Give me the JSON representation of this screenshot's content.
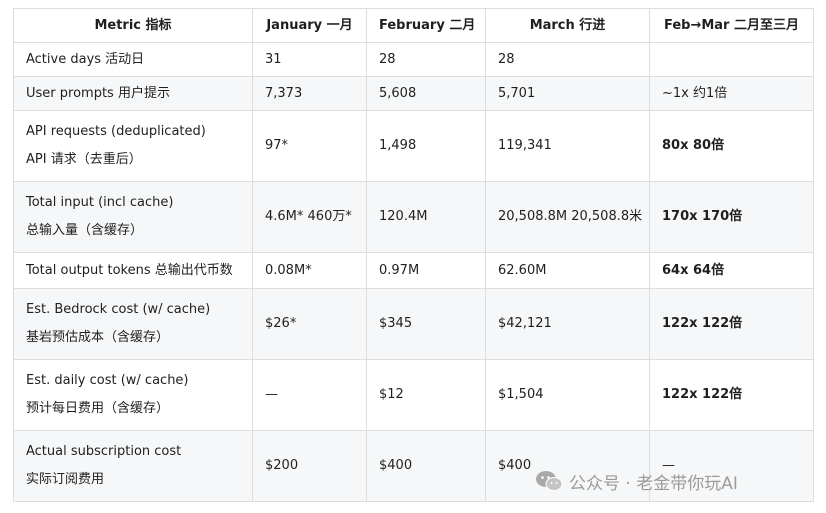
{
  "table": {
    "headers": [
      "Metric  指标",
      "January  一月",
      "February  二月",
      "March  行进",
      "Feb→Mar  二月至三月"
    ],
    "rows": [
      {
        "metric_lines": [
          "Active days  活动日"
        ],
        "jan": "31",
        "feb": "28",
        "mar": "28",
        "change": ""
      },
      {
        "metric_lines": [
          "User prompts  用户提示"
        ],
        "jan": "7,373",
        "feb": "5,608",
        "mar": "5,701",
        "change": "~1x  约1倍"
      },
      {
        "metric_lines": [
          "API requests (deduplicated)",
          "API 请求（去重后）"
        ],
        "jan": "97*",
        "feb": "1,498",
        "mar": "119,341",
        "change": "80x  80倍"
      },
      {
        "metric_lines": [
          "Total input (incl cache)",
          "总输入量（含缓存）"
        ],
        "jan": "4.6M*  460万*",
        "feb": "120.4M",
        "mar": "20,508.8M  20,508.8米",
        "change": "170x  170倍"
      },
      {
        "metric_lines": [
          "Total output tokens  总输出代币数"
        ],
        "jan": "0.08M*",
        "feb": "0.97M",
        "mar": "62.60M",
        "change": "64x  64倍"
      },
      {
        "metric_lines": [
          "Est. Bedrock cost (w/ cache)",
          "基岩预估成本（含缓存）"
        ],
        "jan": "$26*",
        "feb": "$345",
        "mar": "$42,121",
        "change": "122x  122倍"
      },
      {
        "metric_lines": [
          "Est. daily cost (w/ cache)",
          "预计每日费用（含缓存）"
        ],
        "jan": "—",
        "feb": "$12",
        "mar": "$1,504",
        "change": "122x  122倍"
      },
      {
        "metric_lines": [
          "Actual subscription cost",
          "实际订阅费用"
        ],
        "jan": "$200",
        "feb": "$400",
        "mar": "$400",
        "change": "—"
      }
    ]
  },
  "watermark": {
    "text": "公众号 · 老金带你玩AI",
    "icon": "wechat-icon"
  }
}
